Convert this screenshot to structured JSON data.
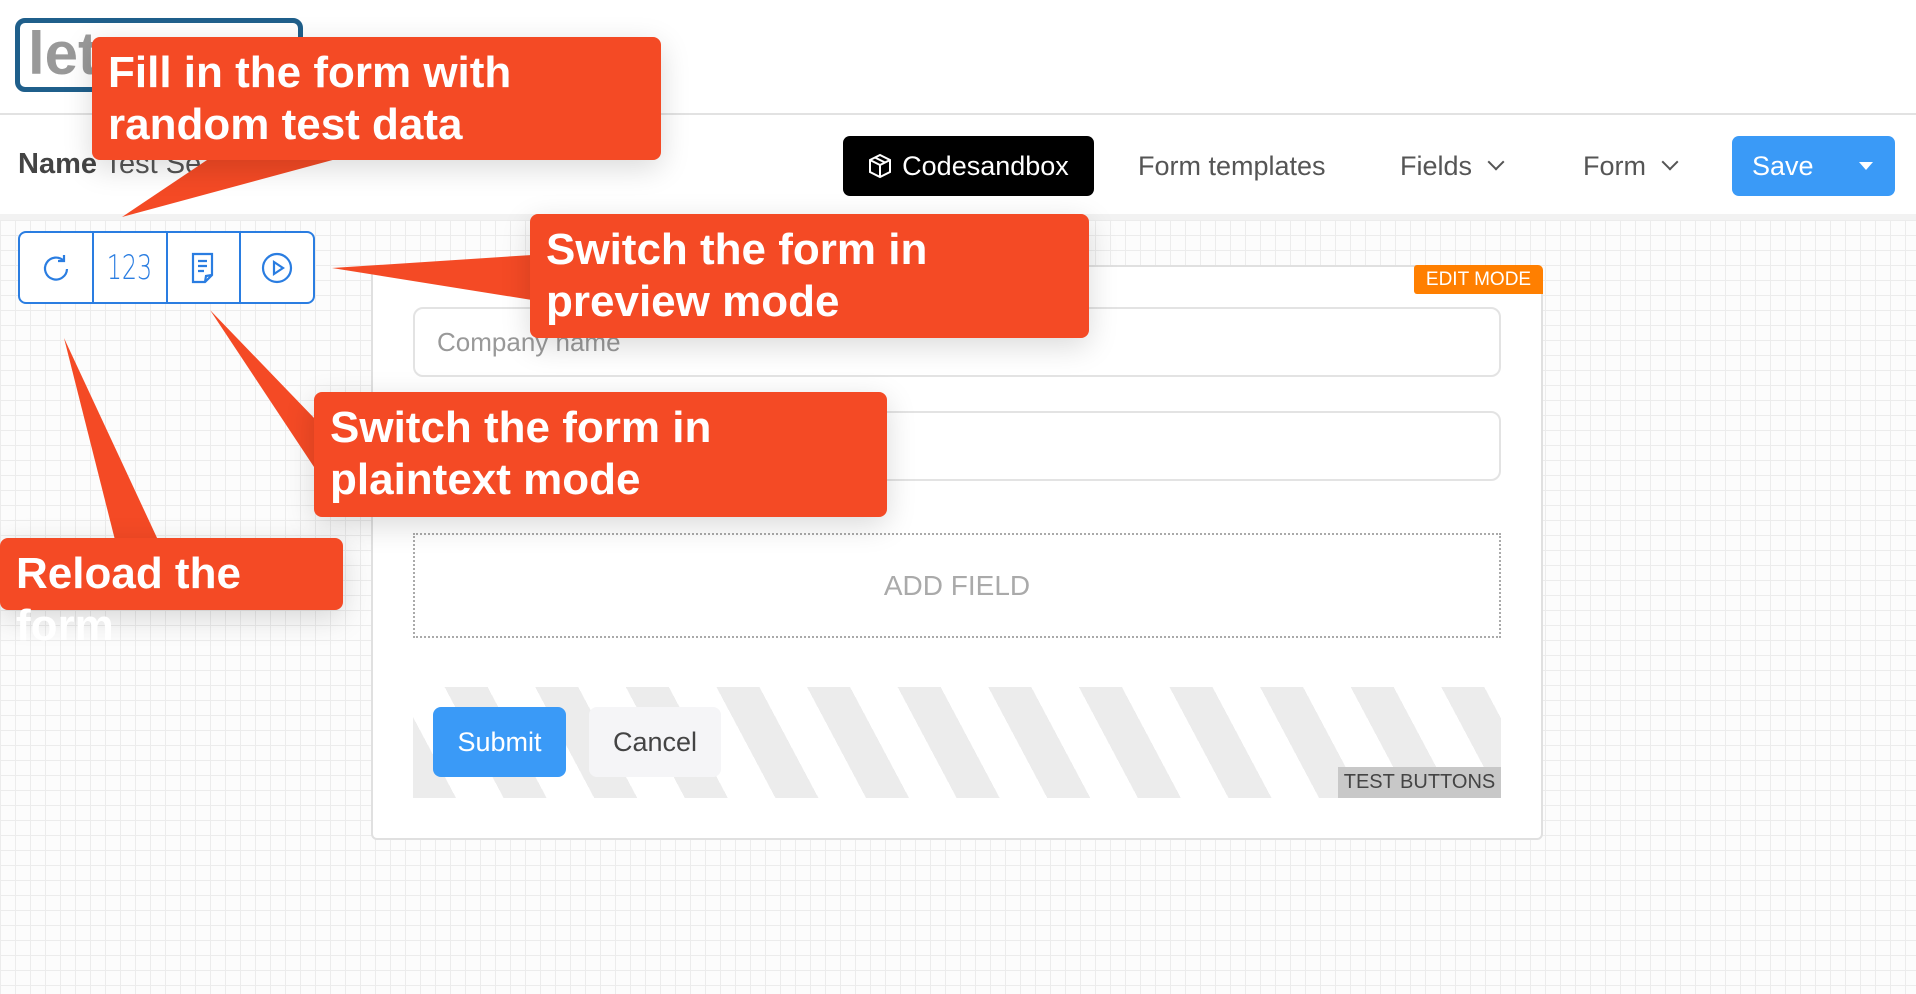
{
  "header": {
    "logo_text": "let",
    "name_label": "Name",
    "name_value": "Test Se"
  },
  "nav": {
    "codesandbox": "Codesandbox",
    "form_templates": "Form templates",
    "fields": "Fields",
    "form": "Form",
    "save": "Save"
  },
  "toolbar": {
    "fill_label": "123",
    "items": [
      "reload-icon",
      "fill-random-data-icon",
      "plaintext-mode-icon",
      "preview-mode-icon"
    ]
  },
  "form": {
    "edit_mode_badge": "EDIT MODE",
    "company_placeholder": "Company name",
    "second_placeholder": "",
    "add_field": "ADD FIELD",
    "submit": "Submit",
    "cancel": "Cancel",
    "test_buttons_badge": "TEST BUTTONS"
  },
  "callouts": {
    "fill": "Fill in the form with random test data",
    "preview": "Switch the form in preview mode",
    "plaintext": "Switch the form in plaintext mode",
    "reload": "Reload the form"
  },
  "colors": {
    "callout": "#f44a25",
    "primary": "#3a9af7",
    "edit_badge": "#ff7f00",
    "toolbar": "#2a7de1"
  }
}
